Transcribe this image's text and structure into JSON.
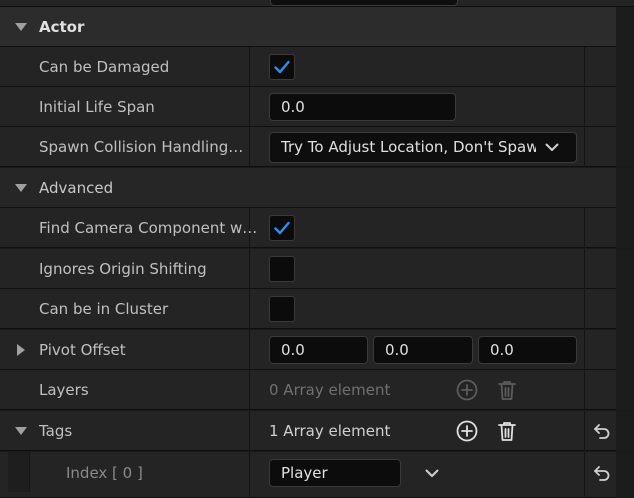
{
  "sections": {
    "actor": {
      "label": "Actor"
    },
    "advanced": {
      "label": "Advanced"
    }
  },
  "properties": {
    "can_be_damaged": {
      "label": "Can be Damaged",
      "checked": true
    },
    "initial_life_span": {
      "label": "Initial Life Span",
      "value": "0.0"
    },
    "spawn_collision": {
      "label": "Spawn Collision Handling…",
      "value": "Try To Adjust Location, Don't Spawn If Still Colliding"
    },
    "find_camera": {
      "label": "Find Camera Component w…",
      "checked": true
    },
    "ignores_origin": {
      "label": "Ignores Origin Shifting",
      "checked": false
    },
    "can_be_in_cluster": {
      "label": "Can be in Cluster",
      "checked": false
    },
    "pivot_offset": {
      "label": "Pivot Offset",
      "x": "0.0",
      "y": "0.0",
      "z": "0.0"
    },
    "layers": {
      "label": "Layers",
      "count_text": "0 Array element"
    },
    "tags": {
      "label": "Tags",
      "count_text": "1 Array element"
    },
    "tags_index0": {
      "label": "Index [ 0 ]",
      "value": "Player"
    }
  },
  "colors": {
    "accent": "#2b8ff0",
    "background": "#242424",
    "category": "#2c2c2c"
  },
  "icons": {
    "expand": "triangle-down-icon",
    "collapse": "triangle-right-icon",
    "add": "add-element-icon",
    "delete": "trash-icon",
    "reset": "reset-to-default-icon",
    "dropdown": "chevron-down-icon",
    "check": "checkmark-icon"
  }
}
